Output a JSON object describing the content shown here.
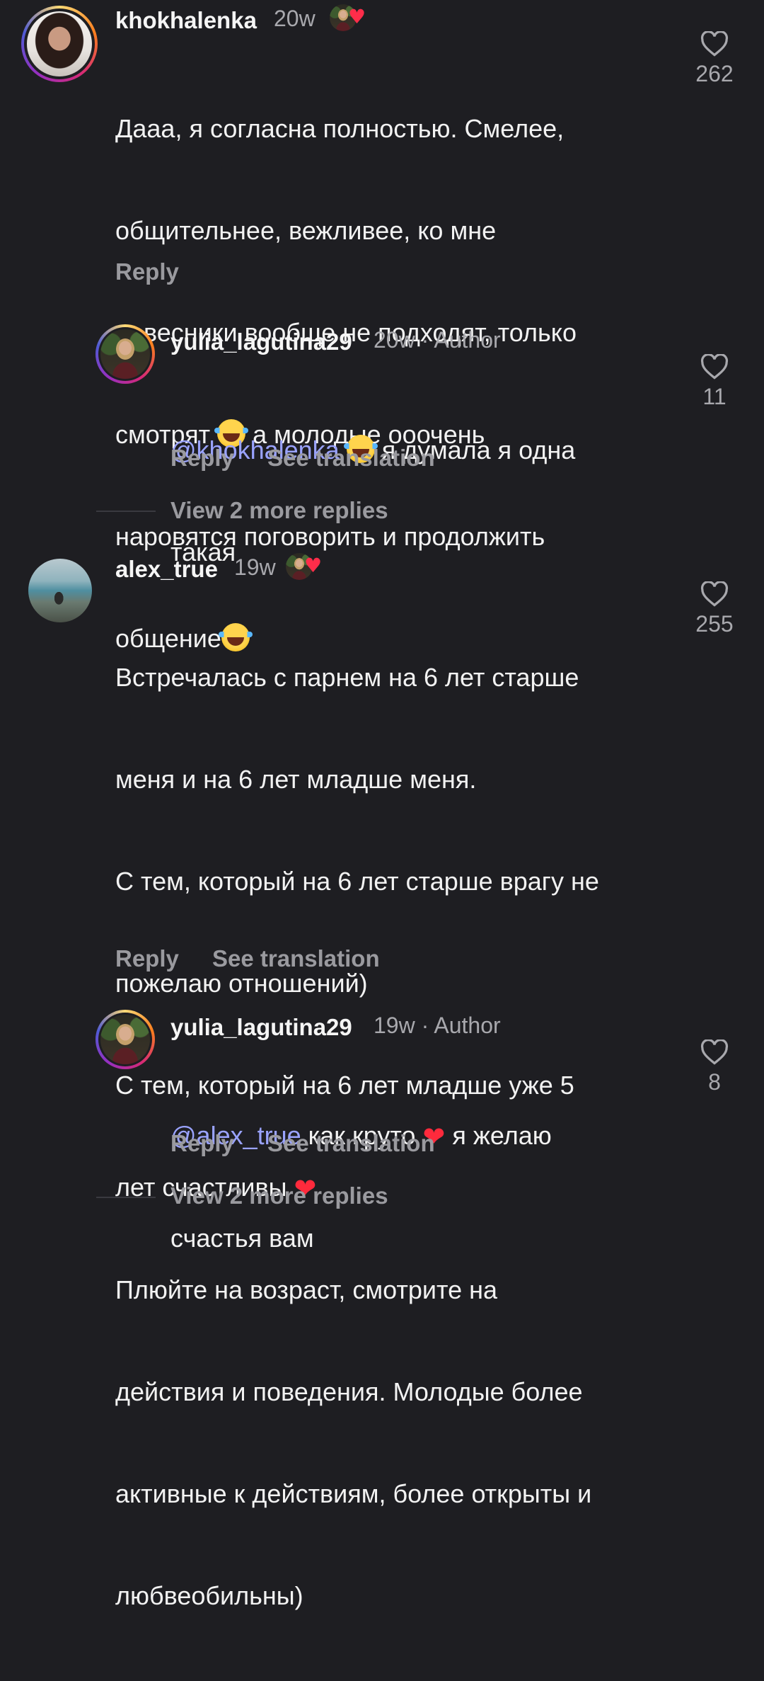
{
  "colors": {
    "background": "#1e1e22",
    "mention": "#9aa3ff",
    "secondary_text": "#a8a8ad",
    "heart_red": "#ff2d4a"
  },
  "comments": [
    {
      "username": "khokhalenka",
      "time": "20w",
      "liked_by_author": true,
      "text_lines": [
        "Дааа, я согласна полностью. Смелее,",
        "общительнее, вежливее, ко мне",
        "ровесники вообще не подходят, только",
        "смотрят",
        "а молодые ооочень",
        "наровятся поговорить и продолжить",
        "общение"
      ],
      "reply_label": "Reply",
      "like_count": "262",
      "avatar_icon": "profile-photo"
    },
    {
      "username": "yulia_lagutina29",
      "time": "20w",
      "author_label": "Author",
      "mention": "@khokhalenka",
      "text_after_line1": "я думала я одна",
      "text_line2": "такая",
      "reply_label": "Reply",
      "translate_label": "See translation",
      "like_count": "11",
      "view_more": "View 2 more replies"
    },
    {
      "username": "alex_true",
      "time": "19w",
      "liked_by_author": true,
      "text_lines": [
        "Встречалась с парнем на 6 лет старше",
        "меня и на 6 лет младше меня.",
        "С тем, который на 6 лет старше врагу не",
        "пожелаю отношений)",
        "С тем, который на 6 лет младше уже 5",
        "лет счастливы",
        "Плюйте на возраст, смотрите на",
        "действия и поведения. Молодые более",
        "активные к действиям, более открыты и",
        "любвеобильны)"
      ],
      "reply_label": "Reply",
      "translate_label": "See translation",
      "like_count": "255"
    },
    {
      "username": "yulia_lagutina29",
      "time": "19w",
      "author_label": "Author",
      "mention": "@alex_true",
      "text_part1": "как круто",
      "text_part2": "я желаю",
      "text_line2": "счастья вам",
      "reply_label": "Reply",
      "translate_label": "See translation",
      "like_count": "8",
      "view_more": "View 2 more replies"
    }
  ]
}
